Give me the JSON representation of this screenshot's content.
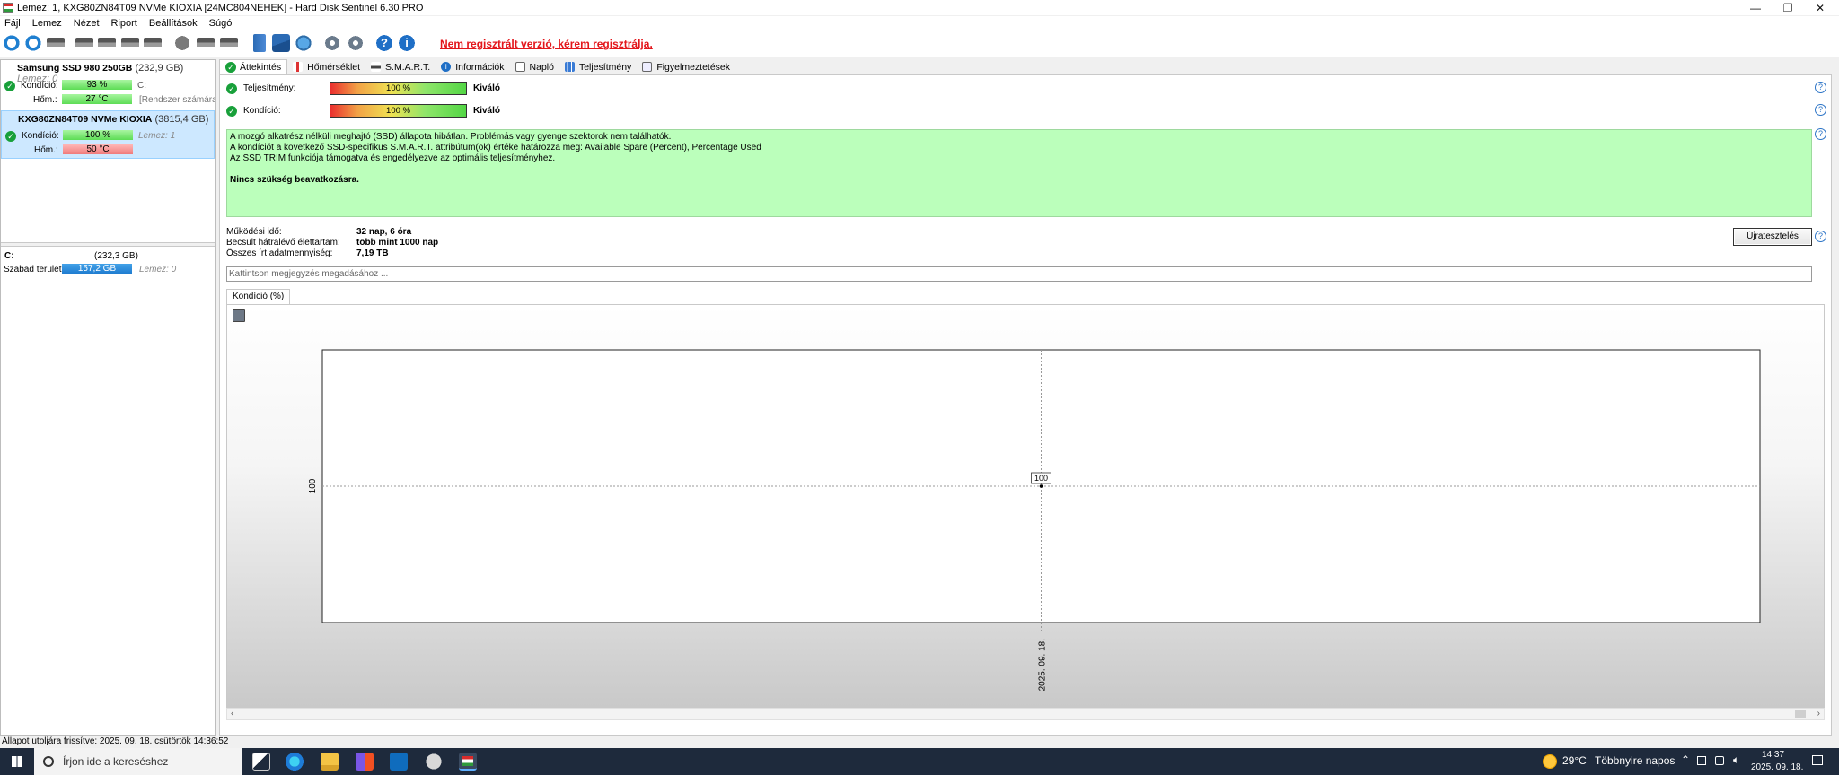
{
  "window": {
    "title": "Lemez: 1, KXG80ZN84T09 NVMe KIOXIA [24MC804NEHEK]  -  Hard Disk Sentinel 6.30 PRO"
  },
  "menu": [
    "Fájl",
    "Lemez",
    "Nézet",
    "Riport",
    "Beállítások",
    "Súgó"
  ],
  "toolbar": {
    "unregistered_text": "Nem regisztrált verzió, kérem regisztrálja."
  },
  "left_pane": {
    "disks": [
      {
        "name": "Samsung SSD 980 250GB",
        "size": "(232,9 GB)",
        "lemez": "Lemez: 0",
        "health_label": "Kondíció:",
        "health_value": "93 %",
        "health_fraction": 0.93,
        "drive_letter": "C:",
        "temp_label": "Hőm.:",
        "temp_value": "27 °C",
        "extra": "[Rendszer számára f"
      },
      {
        "name": "KXG80ZN84T09 NVMe KIOXIA",
        "size": "(3815,4 GB)",
        "health_label": "Kondíció:",
        "health_value": "100 %",
        "lemez": "Lemez: 1",
        "temp_label": "Hőm.:",
        "temp_value": "50 °C"
      }
    ],
    "volume": {
      "letter": "C:",
      "size": "(232,3 GB)",
      "free_label": "Szabad terület",
      "free_value": "157,2 GB",
      "lemez": "Lemez: 0"
    }
  },
  "tabs": [
    "Áttekintés",
    "Hőmérséklet",
    "S.M.A.R.T.",
    "Információk",
    "Napló",
    "Teljesítmény",
    "Figyelmeztetések"
  ],
  "overview": {
    "performance_label": "Teljesítmény:",
    "performance_value": "100 %",
    "performance_rating": "Kiváló",
    "health_label": "Kondíció:",
    "health_value": "100 %",
    "health_rating": "Kiváló",
    "message_lines": [
      "A mozgó alkatrész nélküli meghajtó (SSD) állapota hibátlan. Problémás vagy gyenge szektorok nem találhatók.",
      "A kondíciót a következő SSD-specifikus S.M.A.R.T. attribútum(ok) értéke határozza meg:  Available Spare (Percent), Percentage Used",
      "Az SSD TRIM funkciója támogatva és engedélyezve az optimális teljesítményhez."
    ],
    "message_bold": "Nincs szükség beavatkozásra.",
    "stats": [
      {
        "label": "Működési idő:",
        "value": "32 nap, 6 óra"
      },
      {
        "label": "Becsült hátralévő élettartam:",
        "value": "több mint 1000 nap"
      },
      {
        "label": "Összes írt adatmennyiség:",
        "value": "7,19 TB"
      }
    ],
    "retest_label": "Újratesztelés",
    "note_placeholder": "Kattintson megjegyzés megadásához ...",
    "chart_tab": "Kondíció  (%)"
  },
  "chart_data": {
    "type": "line",
    "x": [
      "2025. 09. 18."
    ],
    "series": [
      {
        "values": [
          100
        ]
      }
    ],
    "ytick_labels": [
      "100"
    ],
    "data_labels": [
      "100"
    ],
    "grid": true
  },
  "status": {
    "text": "Állapot utoljára frissítve: 2025. 09. 18. csütörtök 14:36:52"
  },
  "taskbar": {
    "search_placeholder": "Írjon ide a kereséshez",
    "weather_temp": "29°C",
    "weather_text": "Többnyire napos",
    "time": "14:37",
    "date": "2025. 09. 18."
  }
}
